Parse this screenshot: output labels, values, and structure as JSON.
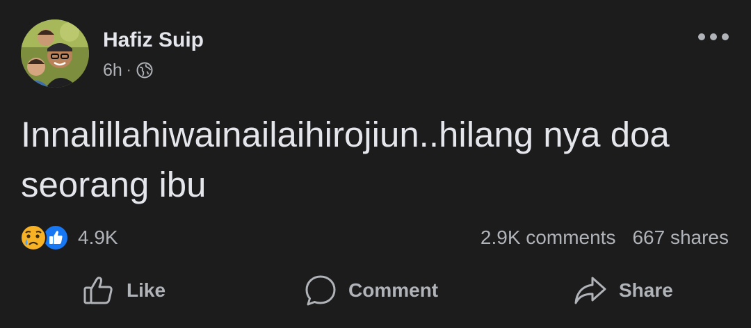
{
  "post": {
    "author": "Hafiz Suip",
    "time": "6h",
    "separator": "·",
    "privacy_icon": "globe-icon",
    "text": "Innalillahiwainailaihirojiun..hilang nya doa seorang ibu"
  },
  "stats": {
    "reaction_icons": [
      "sad-reaction-icon",
      "like-reaction-icon"
    ],
    "reaction_count": "4.9K",
    "comments": "2.9K comments",
    "shares": "667 shares"
  },
  "actions": {
    "like_label": "Like",
    "comment_label": "Comment",
    "share_label": "Share"
  },
  "colors": {
    "background": "#1c1c1d",
    "primary_text": "#e4e6eb",
    "secondary_text": "#b0b3b8",
    "like_blue": "#1877f2",
    "sad_yellow": "#f7b125"
  }
}
